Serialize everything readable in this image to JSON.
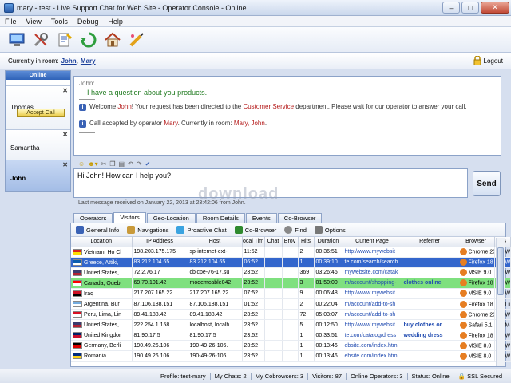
{
  "window": {
    "title": "mary - test - Live Support Chat for Web Site - Operator Console - Online"
  },
  "menu": [
    "File",
    "View",
    "Tools",
    "Debug",
    "Help"
  ],
  "toolbar_icons": [
    "operators-icon",
    "settings-tools-icon",
    "canned-messages-icon",
    "refresh-icon",
    "home-icon",
    "customize-icon"
  ],
  "room": {
    "label": "Currently in room:",
    "members": [
      "John",
      "Mary"
    ],
    "logout_label": "Logout"
  },
  "sidebar": {
    "status": "Online",
    "chats": [
      {
        "name": "Thomas",
        "button": "Accept Call"
      },
      {
        "name": "Samantha"
      },
      {
        "name": "John"
      }
    ]
  },
  "chat": {
    "user_line": "John:",
    "user_msg": "I have a question about you products.",
    "sys1_pre": "Welcome ",
    "sys1_name": "John",
    "sys1_mid": "! Your request has been directed to the ",
    "sys1_dept": "Customer Service",
    "sys1_post": " department.  Please wait for our operator to answer your call.",
    "sys2_pre": "Call accepted by operator ",
    "sys2_op": "Mary",
    "sys2_mid": ". Currently in room: ",
    "sys2_room": "Mary, John",
    "sys2_post": "."
  },
  "editor": {
    "text": "Hi John! How can I help you?",
    "send_label": "Send"
  },
  "last_message": "Last message received on January 22, 2013 at 23:42:06 from John.",
  "watermark": "download",
  "tabs": [
    "Operators",
    "Visitors",
    "Geo-Location",
    "Room Details",
    "Events",
    "Co-Browser"
  ],
  "subtools": [
    "General Info",
    "Navigations",
    "Proactive Chat",
    "Co-Browser",
    "Find",
    "Options"
  ],
  "columns": [
    "Location",
    "IP Address",
    "Host",
    "ocal Tim",
    "Chat",
    "Brov",
    "Hits",
    "Duration",
    "Current Page",
    "Referrer",
    "Browser",
    "OS"
  ],
  "rows": [
    {
      "loc": "Vietnam, Ho Cl",
      "ip": "198.203.175.175",
      "host": "sp-internet-ext-",
      "time": "11:52",
      "hits": "2",
      "dur": "00:36:51",
      "page": "http://www.mywebsit",
      "ref": "",
      "browser": "Chrome 23",
      "os": "Win"
    },
    {
      "loc": "Greece, Attiki,",
      "ip": "83.212.104.65",
      "host": "83.212.104.65",
      "time": "06:52",
      "hits": "1",
      "dur": "00:39:10",
      "page": "te.com/search/search",
      "ref": "",
      "browser": "Firefox 18",
      "os": "Win"
    },
    {
      "loc": "United States,",
      "ip": "72.2.76.17",
      "host": "cblcpe-76-17.su",
      "time": "23:52",
      "hits": "369",
      "dur": "03:26:46",
      "page": "mywebsite.com/catak",
      "ref": "",
      "browser": "MSIE 9.0",
      "os": "Win"
    },
    {
      "loc": "Canada, Queb",
      "ip": "69.70.101.42",
      "host": "modemcable042",
      "time": "23:52",
      "hits": "3",
      "dur": "01:50:00",
      "page": "m/account/shopping-",
      "ref": "clothes online",
      "browser": "Firefox 18",
      "os": "Win"
    },
    {
      "loc": "Iraq",
      "ip": "217.207.165.22",
      "host": "217.207.165.22",
      "time": "07:52",
      "hits": "9",
      "dur": "00:06:48",
      "page": "http://www.mywebsit",
      "ref": "",
      "browser": "MSIE 9.0",
      "os": "Win"
    },
    {
      "loc": "Argentina, Bur",
      "ip": "87.106.188.151",
      "host": "87.106.188.151",
      "time": "01:52",
      "hits": "2",
      "dur": "00:22:04",
      "page": "m/account/add-to-sh",
      "ref": "",
      "browser": "Firefox 18",
      "os": "Linu"
    },
    {
      "loc": "Peru, Lima, Lin",
      "ip": "89.41.188.42",
      "host": "89.41.188.42",
      "time": "23:52",
      "hits": "72",
      "dur": "05:03:07",
      "page": "m/account/add-to-sh",
      "ref": "",
      "browser": "Chrome 23",
      "os": "Win"
    },
    {
      "loc": "United States,",
      "ip": "222.254.1.158",
      "host": "localhost, localh",
      "time": "23:52",
      "hits": "5",
      "dur": "00:12:50",
      "page": "http://www.mywebsit",
      "ref": "buy clothes or",
      "browser": "Safari 5.1",
      "os": "Mac"
    },
    {
      "loc": "United Kingdor",
      "ip": "81.90.17.5",
      "host": "81.90.17.5",
      "time": "23:52",
      "hits": "1",
      "dur": "00:33:51",
      "page": "te.com/catalog/dress",
      "ref": "wedding dress",
      "browser": "Firefox 18",
      "os": "Win"
    },
    {
      "loc": "Germany, Berli",
      "ip": "190.49.26.106",
      "host": "190-49-26-106.",
      "time": "23:52",
      "hits": "1",
      "dur": "00:13:46",
      "page": "ebsite.com/index.html",
      "ref": "",
      "browser": "MSIE 8.0",
      "os": "Win"
    },
    {
      "loc": "Romania",
      "ip": "190.49.26.106",
      "host": "190-49-26-106.",
      "time": "23:52",
      "hits": "1",
      "dur": "00:13:46",
      "page": "ebsite.com/index.html",
      "ref": "",
      "browser": "MSIE 8.0",
      "os": "Win"
    }
  ],
  "status": {
    "profile": "Profile: test-mary",
    "my_chats": "My Chats: 2",
    "cobrowsers": "My Cobrowsers: 3",
    "visitors": "Visitors: 87",
    "operators": "Online Operators: 3",
    "status": "Status: Online",
    "ssl": "SSL Secured"
  }
}
